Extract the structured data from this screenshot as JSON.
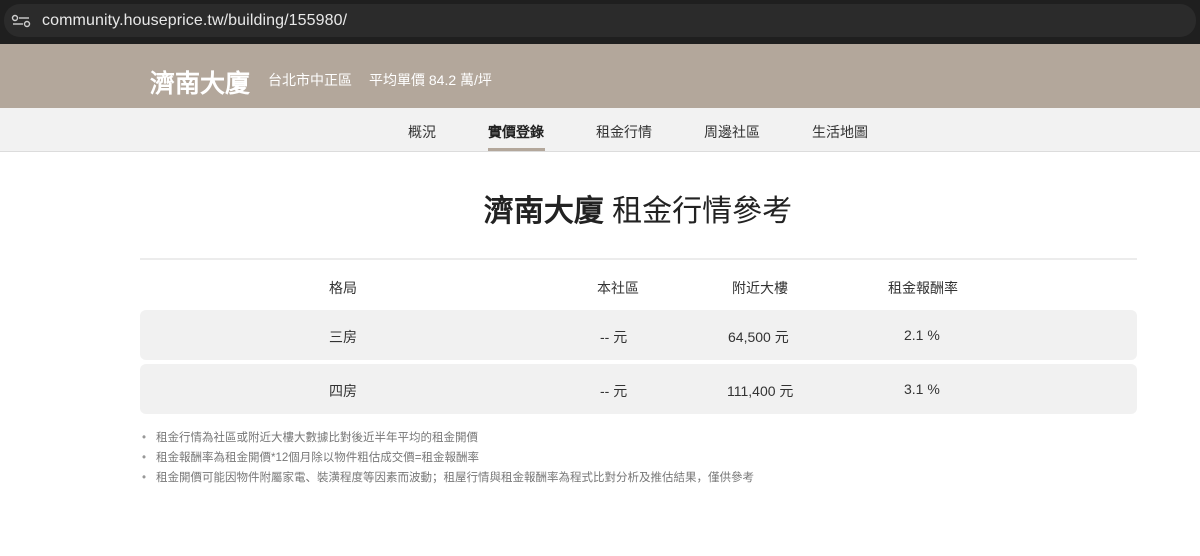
{
  "browser": {
    "url": "community.houseprice.tw/building/155980/"
  },
  "header": {
    "building_name": "濟南大廈",
    "district": "台北市中正區",
    "avg_price": "平均單價 84.2 萬/坪"
  },
  "tabs": [
    {
      "label": "概況",
      "active": false
    },
    {
      "label": "實價登錄",
      "active": true
    },
    {
      "label": "租金行情",
      "active": false
    },
    {
      "label": "周邊社區",
      "active": false
    },
    {
      "label": "生活地圖",
      "active": false
    }
  ],
  "main": {
    "title_bold": "濟南大廈",
    "title_rest": "租金行情參考"
  },
  "table": {
    "headers": [
      "格局",
      "本社區",
      "附近大樓",
      "租金報酬率"
    ],
    "rows": [
      {
        "layout": "三房",
        "community": "-- 元",
        "nearby": "64,500 元",
        "yield": "2.1 %"
      },
      {
        "layout": "四房",
        "community": "-- 元",
        "nearby": "111,400 元",
        "yield": "3.1 %"
      }
    ]
  },
  "notes": [
    "租金行情為社區或附近大樓大數據比對後近半年平均的租金開價",
    "租金報酬率為租金開價*12個月除以物件粗估成交價=租金報酬率",
    " 租金開價可能因物件附屬家電、裝潢程度等因素而波動；租屋行情與租金報酬率為程式比對分析及推估結果，僅供參考"
  ]
}
